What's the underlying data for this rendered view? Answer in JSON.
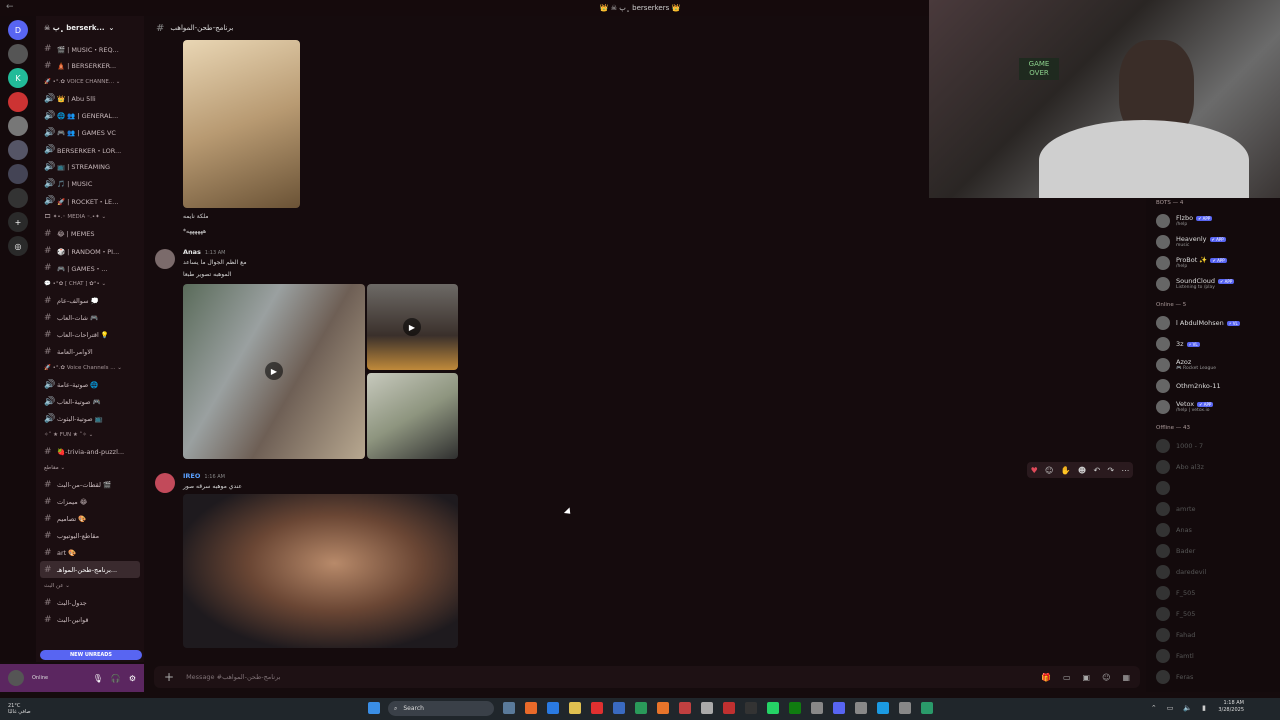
{
  "topbar": {
    "title": "👑 ☠ ﮼پ berserkers 👑"
  },
  "servers": [
    "D",
    "",
    "K",
    "",
    "",
    "",
    "",
    "",
    "+",
    "◎"
  ],
  "guild": {
    "name": "☠ ﮼پ berserk..."
  },
  "channels": [
    {
      "t": "ch",
      "icon": "#",
      "label": "🎬 | MUSIC・REQ..."
    },
    {
      "t": "ch",
      "icon": "#",
      "label": "🛕 | BERSERKER..."
    },
    {
      "t": "cat",
      "label": "🚀 •°.✿ VOICE CHANNE...  ⌄"
    },
    {
      "t": "ch",
      "icon": "🔊",
      "label": "👑 | Abu 5lli"
    },
    {
      "t": "ch",
      "icon": "🔊",
      "label": "🌐 👥 | GENERAL..."
    },
    {
      "t": "ch",
      "icon": "🔊",
      "label": "🎮 👥 | GAMES VC"
    },
    {
      "t": "ch",
      "icon": "🔊",
      "label": "BERSERKER・LOR..."
    },
    {
      "t": "ch",
      "icon": "🔊",
      "label": "📺 | STREAMING"
    },
    {
      "t": "ch",
      "icon": "🔊",
      "label": "🎵 | MUSIC"
    },
    {
      "t": "ch",
      "icon": "🔊",
      "label": "🚀 | ROCKET・LE..."
    },
    {
      "t": "cat",
      "label": "🎞 ✦•.◦ MEDIA ◦.•✦  ⌄"
    },
    {
      "t": "ch",
      "icon": "#",
      "label": "😂 | MEMES"
    },
    {
      "t": "ch",
      "icon": "#",
      "label": "🎲 | RANDOM・PI..."
    },
    {
      "t": "ch",
      "icon": "#",
      "label": "🎮 | GAMES・..."
    },
    {
      "t": "cat",
      "label": "💬 •°✿ [ CHAT ] ✿°•  ⌄"
    },
    {
      "t": "ch",
      "icon": "#",
      "label": "سوالف-عام 💭"
    },
    {
      "t": "ch",
      "icon": "#",
      "label": "شات-العاب 🎮"
    },
    {
      "t": "ch",
      "icon": "#",
      "label": "اقتراحات-العاب 💡"
    },
    {
      "t": "ch",
      "icon": "#",
      "label": "الاوامر-العامة"
    },
    {
      "t": "cat",
      "label": "🚀 •°.✿ Voice Channels ...  ⌄"
    },
    {
      "t": "ch",
      "icon": "🔊",
      "label": "صوتية-عامة 🌐"
    },
    {
      "t": "ch",
      "icon": "🔊",
      "label": "صوتية-العاب 🎮"
    },
    {
      "t": "ch",
      "icon": "🔊",
      "label": "صوتية-البثوث 📺"
    },
    {
      "t": "cat",
      "label": "✧˚ ★ FUN ★ ˚✧  ⌄"
    },
    {
      "t": "ch",
      "icon": "#",
      "label": "🍓-trivia-and-puzzl..."
    },
    {
      "t": "cat",
      "label": "مقاطع  ⌄"
    },
    {
      "t": "ch",
      "icon": "#",
      "label": "لقطات-من-البث 🎬"
    },
    {
      "t": "ch",
      "icon": "#",
      "label": "ميمزات 😂"
    },
    {
      "t": "ch",
      "icon": "#",
      "label": "تصاميم 🎨"
    },
    {
      "t": "ch",
      "icon": "#",
      "label": "مقاطع-اليوتيوب"
    },
    {
      "t": "ch",
      "icon": "#",
      "label": "art 🎨"
    },
    {
      "t": "ch",
      "icon": "#",
      "label": "برنامج-طحن-المواهـ...",
      "active": true
    },
    {
      "t": "cat",
      "label": "عن البث  ⌄"
    },
    {
      "t": "ch",
      "icon": "#",
      "label": "جدول-البث"
    },
    {
      "t": "ch",
      "icon": "#",
      "label": "قوانين-البث"
    }
  ],
  "new_unreads": "NEW UNREADS",
  "user": {
    "status": "Online"
  },
  "channel_header": "برنامج-طحن-المواهب",
  "messages": {
    "m0_line1": "ملكة نايمه",
    "m0_line2": "*ههههههه",
    "anas": {
      "author": "Anas",
      "time": "1:13 AM",
      "line1": "مع الظم الجوال ما يساعد",
      "line2": "الموهبه تصوير طبعا"
    },
    "ireo": {
      "author": "IREO",
      "time": "1:16 AM",
      "line1": "عندي موهبه سرقه صور"
    }
  },
  "composer": {
    "placeholder": "Message #برنامج-طحن-المواهب"
  },
  "members": {
    "bots_header": "BOTS — 4",
    "bots": [
      {
        "name": "Flzbo",
        "tag": "✔ APP",
        "status": "/help"
      },
      {
        "name": "Heavenly",
        "tag": "✔ APP",
        "status": "music"
      },
      {
        "name": "ProBot ✨",
        "tag": "✔ APP",
        "status": "/help"
      },
      {
        "name": "SoundCloud",
        "tag": "✔ APP",
        "status": "Listening to /play"
      }
    ],
    "online_header": "Online — 5",
    "online": [
      {
        "name": "l AbdulMohsen",
        "tag": "⚡ VL",
        "status": ""
      },
      {
        "name": "3z",
        "tag": "⚡ VL",
        "status": ""
      },
      {
        "name": "Azoz",
        "tag": "",
        "status": "🎮 Rocket League"
      },
      {
        "name": "Othm2nko-11",
        "tag": "",
        "status": ""
      },
      {
        "name": "Vetox",
        "tag": "✔ APP",
        "status": "/help | vetox.io"
      }
    ],
    "offline_header": "Offline — 43",
    "offline": [
      {
        "name": "1000 - 7"
      },
      {
        "name": "Abo al3z"
      },
      {
        "name": ""
      },
      {
        "name": "amrte"
      },
      {
        "name": "Anas"
      },
      {
        "name": "Bader"
      },
      {
        "name": "daredevil"
      },
      {
        "name": "F_505"
      },
      {
        "name": "F_505"
      },
      {
        "name": "Fahad"
      },
      {
        "name": "Famtl"
      },
      {
        "name": "Feras"
      }
    ]
  },
  "taskbar": {
    "weather_temp": "21°C",
    "weather_desc": "صافي غالبًا",
    "search": "Search",
    "time": "1:18 AM",
    "date": "3/28/2025"
  },
  "webcam": {
    "sign": "GAME OVER"
  }
}
